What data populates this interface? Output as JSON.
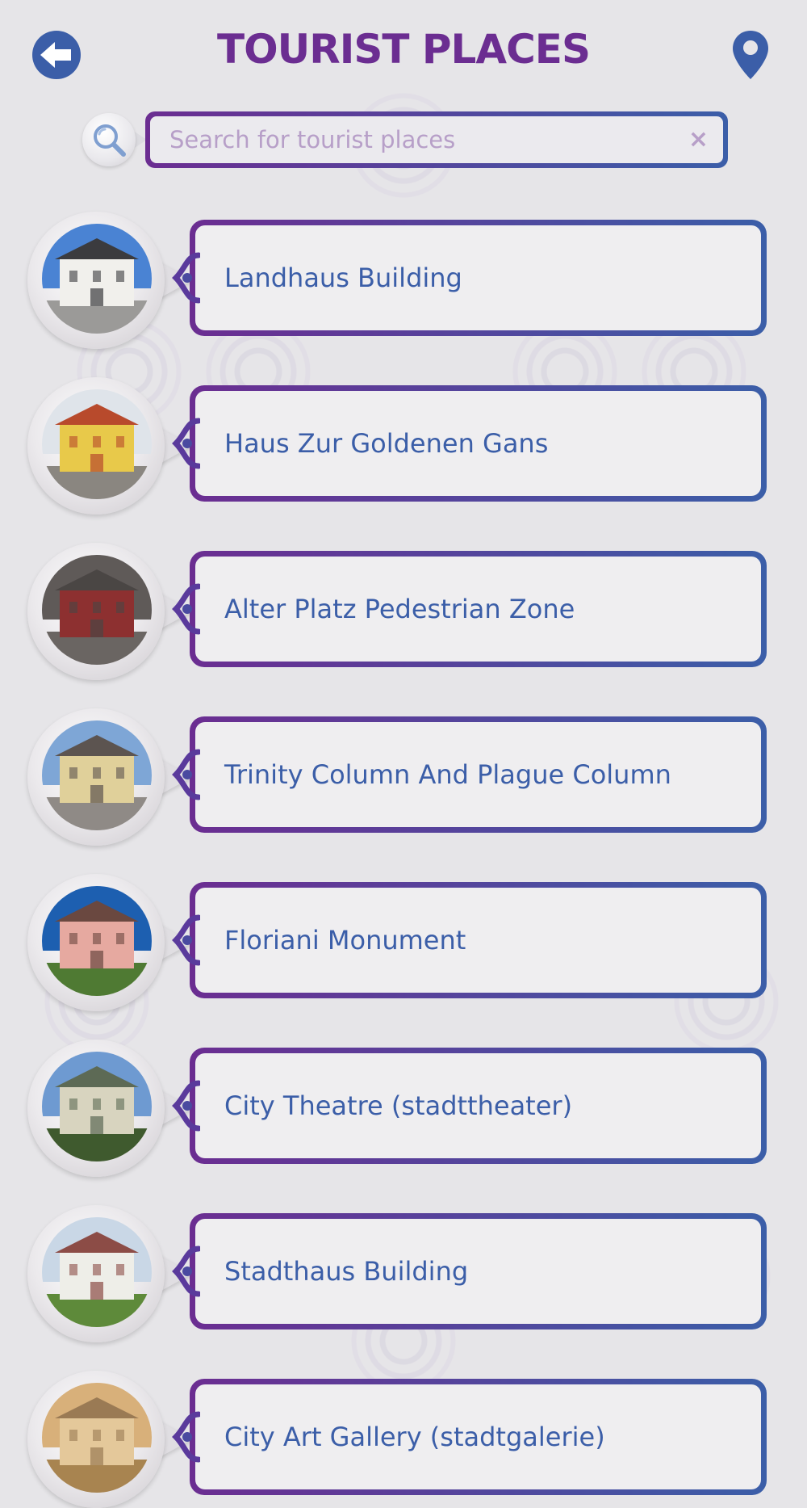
{
  "header": {
    "title": "TOURIST PLACES"
  },
  "search": {
    "placeholder": "Search for tourist places",
    "value": "",
    "clear_glyph": "×"
  },
  "places": [
    {
      "name": "Landhaus Building",
      "sky": "#4a83d3",
      "ground": "#9b9a98",
      "building": "#f1f0ec",
      "roof": "#3b3b3e"
    },
    {
      "name": "Haus Zur Goldenen Gans",
      "sky": "#dfe4ea",
      "ground": "#8a8680",
      "building": "#e8c94a",
      "roof": "#b84a2c"
    },
    {
      "name": "Alter Platz Pedestrian Zone",
      "sky": "#5f5a58",
      "ground": "#6a6562",
      "building": "#8d3030",
      "roof": "#4a4644"
    },
    {
      "name": "Trinity Column And Plague Column",
      "sky": "#7ea6d6",
      "ground": "#8f8a86",
      "building": "#e0d09a",
      "roof": "#5c5450"
    },
    {
      "name": "Floriani Monument",
      "sky": "#1d5fb0",
      "ground": "#4f7a33",
      "building": "#e6a9a0",
      "roof": "#6a4840"
    },
    {
      "name": "City Theatre (stadttheater)",
      "sky": "#6e9ad1",
      "ground": "#3f5a2e",
      "building": "#d8d4bf",
      "roof": "#5d6a55"
    },
    {
      "name": "Stadthaus Building",
      "sky": "#c9d7e6",
      "ground": "#5e8a3a",
      "building": "#eeeee8",
      "roof": "#8c4c46"
    },
    {
      "name": "City Art Gallery (stadtgalerie)",
      "sky": "#d8b07a",
      "ground": "#a88450",
      "building": "#e4c89a",
      "roof": "#9a7a54"
    }
  ],
  "colors": {
    "title": "#6b2d91",
    "accent_blue": "#3b5ea8",
    "accent_purple": "#6b2d91",
    "background": "#e6e5e8"
  },
  "icons": {
    "back": "back-arrow-icon",
    "location": "location-pin-icon",
    "search": "magnifier-icon",
    "clear": "close-icon"
  }
}
